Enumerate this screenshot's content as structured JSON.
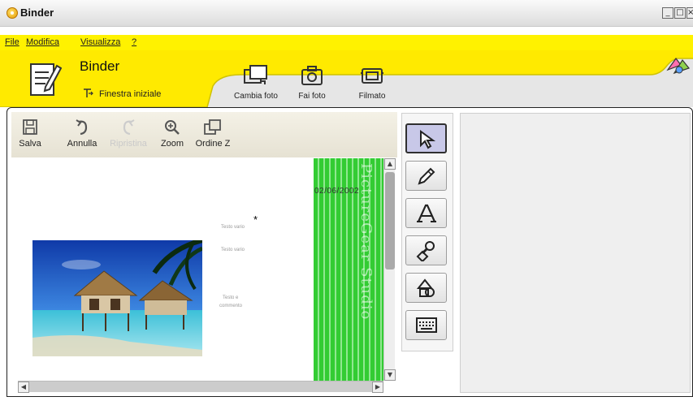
{
  "window": {
    "title": "Binder",
    "controls": [
      "_",
      "□",
      "×"
    ]
  },
  "menu": [
    {
      "label": "File"
    },
    {
      "label": "Modifica"
    },
    {
      "label": "Visualizza"
    },
    {
      "label": "?"
    }
  ],
  "header": {
    "section_title": "Binder",
    "start_window_label": "Finestra iniziale",
    "buttons": [
      {
        "label": "Cambia foto",
        "icon": "change-photo-icon"
      },
      {
        "label": "Fai foto",
        "icon": "camera-icon"
      },
      {
        "label": "Filmato",
        "icon": "film-icon"
      }
    ]
  },
  "toolbar": {
    "items": [
      {
        "label": "Salva",
        "icon": "save-icon",
        "enabled": true
      },
      {
        "label": "Annulla",
        "icon": "undo-icon",
        "enabled": true
      },
      {
        "label": "Ripristina",
        "icon": "redo-icon",
        "enabled": false
      },
      {
        "label": "Zoom",
        "icon": "zoom-icon",
        "enabled": true
      },
      {
        "label": "Ordine Z",
        "icon": "z-order-icon",
        "enabled": true
      }
    ]
  },
  "canvas": {
    "date": "02/06/2002",
    "watermark": "PictureGear Studio",
    "star": "*",
    "labels": [
      "Testo vario",
      "Testo vario",
      "Testo e",
      "commento"
    ]
  },
  "palette": {
    "tools": [
      {
        "name": "select-tool",
        "icon": "arrow-cursor-icon",
        "active": true
      },
      {
        "name": "pencil-tool",
        "icon": "pencil-icon",
        "active": false
      },
      {
        "name": "text-tool",
        "icon": "text-a-icon",
        "active": false
      },
      {
        "name": "stamp-tool",
        "icon": "stamp-icon",
        "active": false
      },
      {
        "name": "shapes-tool",
        "icon": "shapes-icon",
        "active": false
      },
      {
        "name": "keyboard-tool",
        "icon": "keyboard-icon",
        "active": false
      }
    ]
  },
  "colors": {
    "menu_bg": "#fff200",
    "header_tab": "#ffea00",
    "stripe_green": "#33cc33",
    "active_tool": "#c8c8e8"
  }
}
